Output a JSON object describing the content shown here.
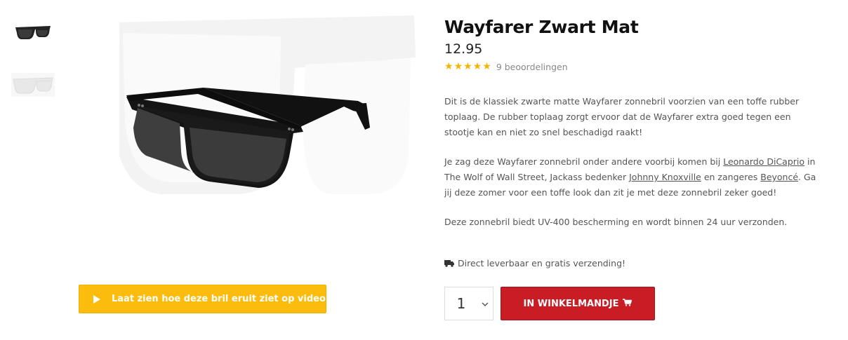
{
  "product": {
    "title": "Wayfarer Zwart Mat",
    "price": "12.95",
    "rating_stars": 5,
    "reviews": "9 beoordelingen"
  },
  "description": {
    "p1": "Dit is de klassiek zwarte matte Wayfarer zonnebril voorzien van een toffe rubber toplaag. De rubber toplaag zorgt ervoor dat de Wayfarer extra goed tegen een stootje kan en niet zo snel beschadigd raakt!",
    "p2_a": "Je zag deze Wayfarer zonnebril onder andere voorbij komen bij ",
    "p2_link1": "Leonardo DiCaprio",
    "p2_b": " in The Wolf of Wall Street, Jackass bedenker ",
    "p2_link2": "Johnny Knoxville",
    "p2_c": " en zangeres ",
    "p2_link3": "Beyoncé",
    "p2_d": ". Ga jij deze zomer voor een toffe look dan zit je met deze zonnebril zeker goed!",
    "p3": "Deze zonnebril biedt UV-400 bescherming en wordt binnen 24 uur verzonden."
  },
  "shipping": "Direct leverbaar en gratis verzending!",
  "quantity": "1",
  "cart_button": "IN WINKELMANDJE",
  "video_button": "Laat zien hoe deze bril eruit ziet op video",
  "colors": {
    "star": "#f5b400",
    "video": "#fbbc0e",
    "cart": "#c81d25"
  },
  "icons": {
    "play": "play-icon",
    "truck": "truck-icon",
    "cart": "cart-icon",
    "chevron": "chevron-down-icon"
  }
}
